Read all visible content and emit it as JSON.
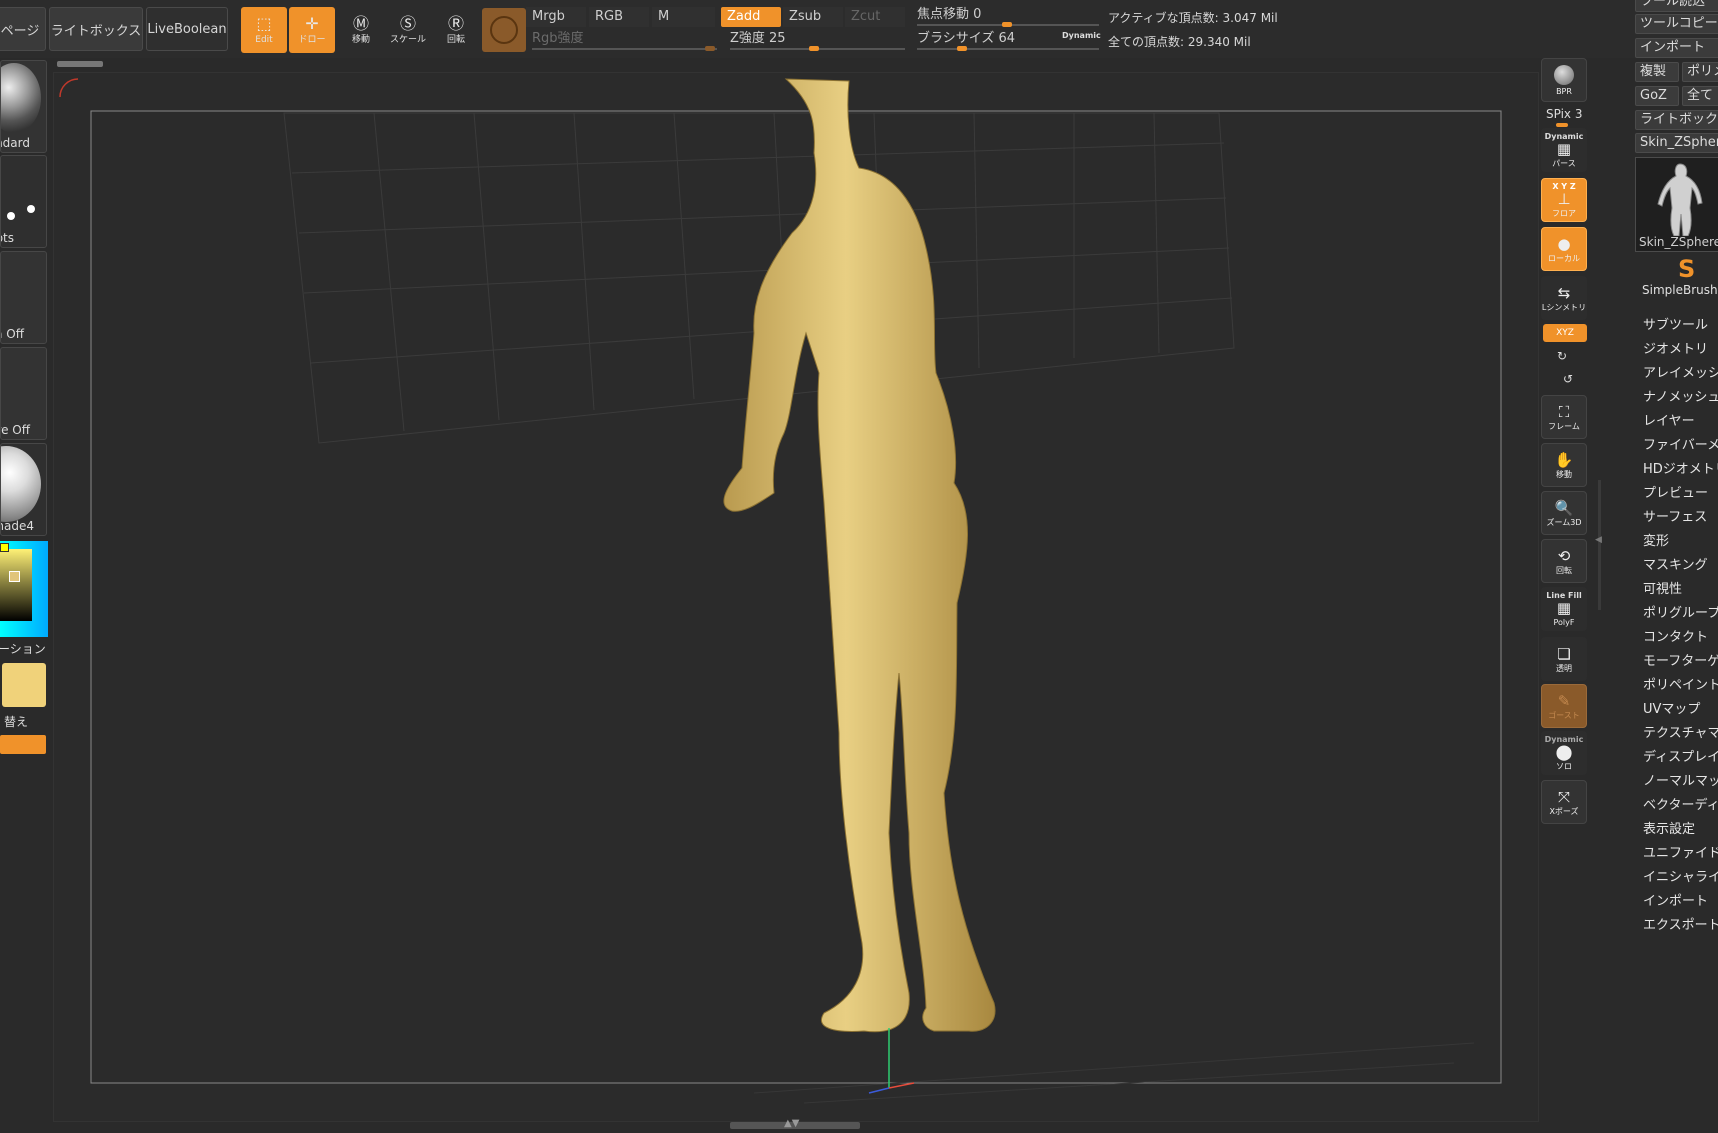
{
  "top_toolbar": {
    "page_tab": "ページ",
    "lightbox": "ライトボックス",
    "liveboolean": "LiveBoolean",
    "edit_label": "Edit",
    "draw_label": "ドロー",
    "move_label": "移動",
    "scale_label": "スケール",
    "rotate_label": "回転",
    "mrgb": "Mrgb",
    "rgb": "RGB",
    "m": "M",
    "zadd": "Zadd",
    "zsub": "Zsub",
    "zcut": "Zcut",
    "rgb_intensity": "Rgb強度",
    "z_intensity": "Z強度 25",
    "focal_shift": "焦点移動 0",
    "brush_size": "ブラシサイズ 64",
    "dynamic": "Dynamic",
    "active_points": "アクティブな頂点数: 3.047 Mil",
    "total_points": "全ての頂点数: 29.340 Mil"
  },
  "left_shelf": {
    "brush": "ndard",
    "stroke": "ots",
    "alpha": "a Off",
    "texture": "re Off",
    "material": "hade4",
    "gradient": "ーション",
    "switch_color": "替え",
    "icon_dots": "dots-icon"
  },
  "right_shelf": {
    "bpr": "BPR",
    "spix": "SPix 3",
    "dynamic": "Dynamic",
    "persp": "パース",
    "floor": "フロア",
    "floor_axes": "X Y Z",
    "local": "ローカル",
    "lsym": "Lシンメトリ",
    "xyz": "XYZ",
    "frame": "フレーム",
    "move": "移動",
    "zoom3d": "ズーム3D",
    "rotate": "回転",
    "linefill": "Line Fill",
    "polyf": "PolyF",
    "transp": "透明",
    "ghost": "ゴースト",
    "solo_dynamic": "Dynamic",
    "solo": "ソロ",
    "xpose": "Xポーズ"
  },
  "tool_palette": {
    "load": "ツール読込",
    "copy": "ツールコピー",
    "import": "インポート",
    "clone": "複製",
    "polymesh": "ポリメ",
    "goz": "GoZ",
    "all": "全て",
    "lightbox_tools": "ライトボック",
    "current_tool": "Skin_ZSphere",
    "thumb_label": "Skin_ZSphere",
    "simplebrush": "SimpleBrush",
    "menu": [
      "サブツール",
      "ジオメトリ",
      "アレイメッシ",
      "ナノメッシュ",
      "レイヤー",
      "ファイバーメ",
      "HDジオメトリ",
      "プレビュー",
      "サーフェス",
      "変形",
      "マスキング",
      "可視性",
      "ポリグループ",
      "コンタクト",
      "モーフターゲ",
      "ポリペイント",
      "UVマップ",
      "テクスチャマ",
      "ディスプレイ",
      "ノーマルマッ",
      "ベクターディ",
      "表示設定",
      "ユニファイド",
      "イニシャライ",
      "インポート",
      "エクスポート"
    ]
  },
  "colors": {
    "accent": "#f0922a",
    "model": "#e1c57a",
    "background": "#2a2a2a"
  }
}
